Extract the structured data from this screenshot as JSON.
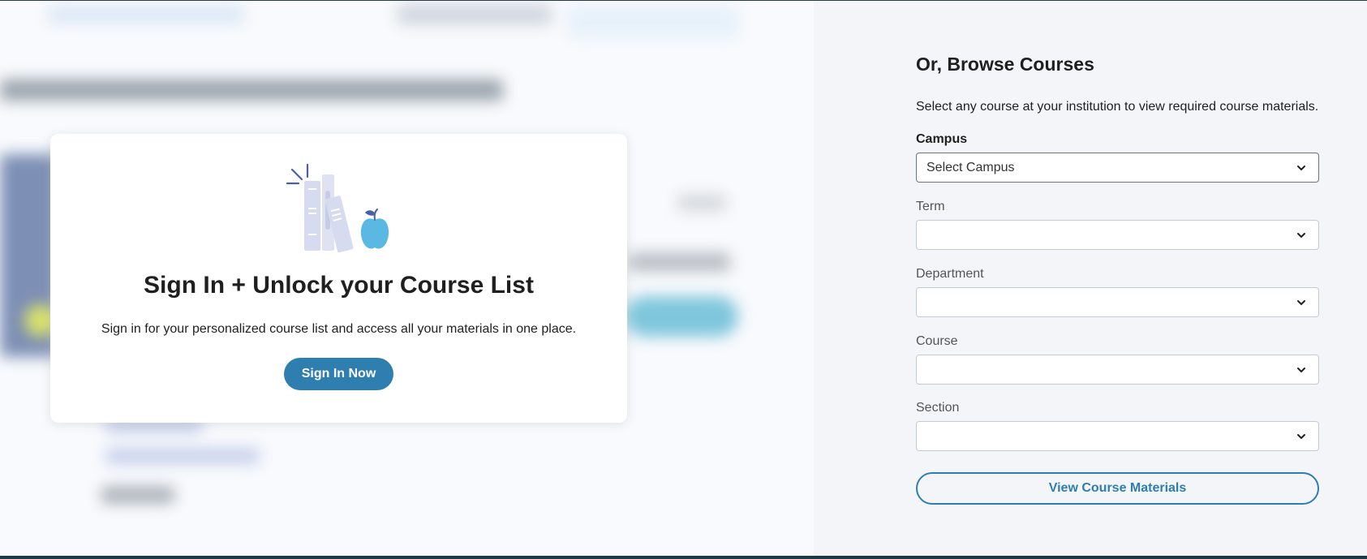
{
  "signin": {
    "title": "Sign In + Unlock your Course List",
    "subtitle": "Sign in for your personalized course list and access all your materials in one place.",
    "button_label": "Sign In Now"
  },
  "browse": {
    "title": "Or, Browse Courses",
    "description": "Select any course at your institution to view required course materials.",
    "fields": [
      {
        "label": "Campus",
        "value": "Select Campus"
      },
      {
        "label": "Term",
        "value": ""
      },
      {
        "label": "Department",
        "value": ""
      },
      {
        "label": "Course",
        "value": ""
      },
      {
        "label": "Section",
        "value": ""
      }
    ],
    "button_label": "View Course Materials"
  },
  "colors": {
    "primary": "#2e7eb0",
    "panel_bg": "#f3f5f9",
    "illustration_books": "#d7dbef",
    "illustration_apple": "#5ab8e3",
    "illustration_accent": "#4a5fa8"
  }
}
